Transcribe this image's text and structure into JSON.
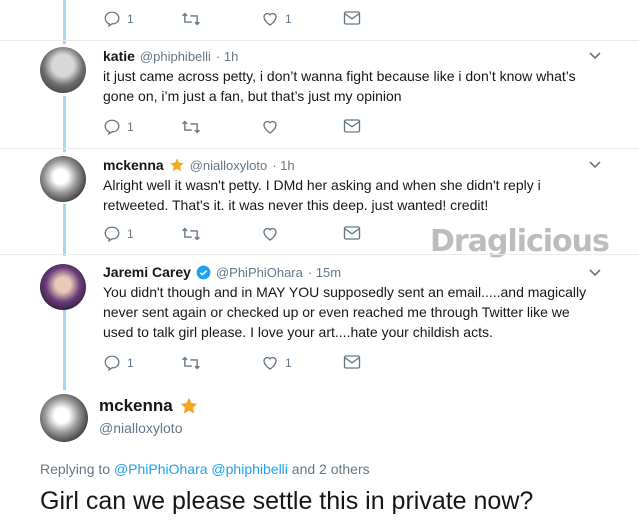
{
  "tweets": [
    {
      "reply_count": "1",
      "like_count": "1"
    },
    {
      "name": "katie",
      "handle": "@phiphibelli",
      "time": "· 1h",
      "text": "it just came across petty, i don’t wanna fight because like i don’t know what’s gone on, i’m just a fan, but that’s just my opinion",
      "reply_count": "1"
    },
    {
      "name": "mckenna",
      "handle": "@nialloxyloto",
      "time": "· 1h",
      "text": "Alright well it wasn't petty. I DMd her asking and when she didn't reply i retweeted. That's it. it was never this deep. just wanted! credit!",
      "reply_count": "1"
    },
    {
      "name": "Jaremi Carey",
      "handle": "@PhiPhiOhara",
      "time": "· 15m",
      "text": "You didn't though and in MAY YOU supposedly sent an email.....and magically never sent again or checked up or even reached me through Twitter like we used to talk girl please. I love your art....hate your childish acts.",
      "reply_count": "1",
      "like_count": "1"
    }
  ],
  "focused": {
    "name": "mckenna",
    "handle": "@nialloxyloto",
    "replying_prefix": "Replying to",
    "replying_to_1": "@PhiPhiOhara",
    "replying_to_2": "@phiphibelli",
    "replying_suffix": "and 2 others",
    "text": "Girl can we please settle this in private now?"
  },
  "watermark": "Draglicious",
  "colors": {
    "link": "#1da1f2",
    "thread_line": "#a8d6f0",
    "muted": "#657786",
    "star": "#f5a623"
  }
}
